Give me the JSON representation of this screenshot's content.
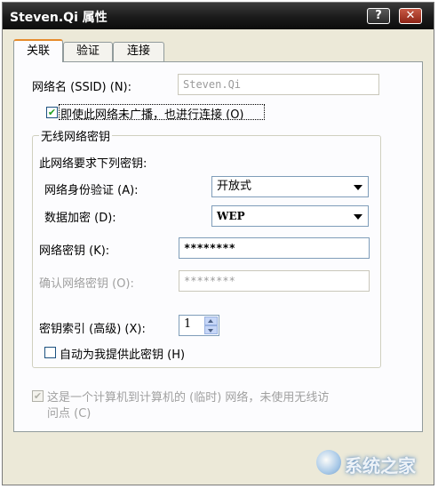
{
  "window": {
    "title": "Steven.Qi 属性",
    "help_button": "?",
    "close_button": "✕"
  },
  "tabs": [
    {
      "label": "关联",
      "active": true
    },
    {
      "label": "验证",
      "active": false
    },
    {
      "label": "连接",
      "active": false
    }
  ],
  "network": {
    "ssid_label": "网络名 (SSID) (N):",
    "ssid_value": "Steven.Qi",
    "broadcast_checkbox": {
      "label": "即使此网络未广播，也进行连接 (O)",
      "checked": true
    }
  },
  "wireless_key": {
    "group_title": "无线网络密钥",
    "intro": "此网络要求下列密钥:",
    "auth_label": "网络身份验证 (A):",
    "auth_value": "开放式",
    "encryption_label": "数据加密 (D):",
    "encryption_value": "WEP",
    "key_label": "网络密钥 (K):",
    "key_value": "********",
    "confirm_label": "确认网络密钥 (O):",
    "confirm_value": "********",
    "key_index_label": "密钥索引 (高级) (X):",
    "key_index_value": "1",
    "auto_key_checkbox": {
      "label": "自动为我提供此密钥 (H)",
      "checked": false
    }
  },
  "adhoc": {
    "checkbox_label_line1": "这是一个计算机到计算机的 (临时) 网络，未使用无线访",
    "checkbox_label_line2": "问点 (C)",
    "checked": true,
    "disabled": true
  },
  "watermark": "系统之家",
  "colors": {
    "titlebar": "#1a1a1a",
    "dialog_bg": "#ece9d8",
    "panel_bg": "#fcfcfe",
    "active_tab_accent": "#e68b2c",
    "check_green": "#21a121"
  }
}
